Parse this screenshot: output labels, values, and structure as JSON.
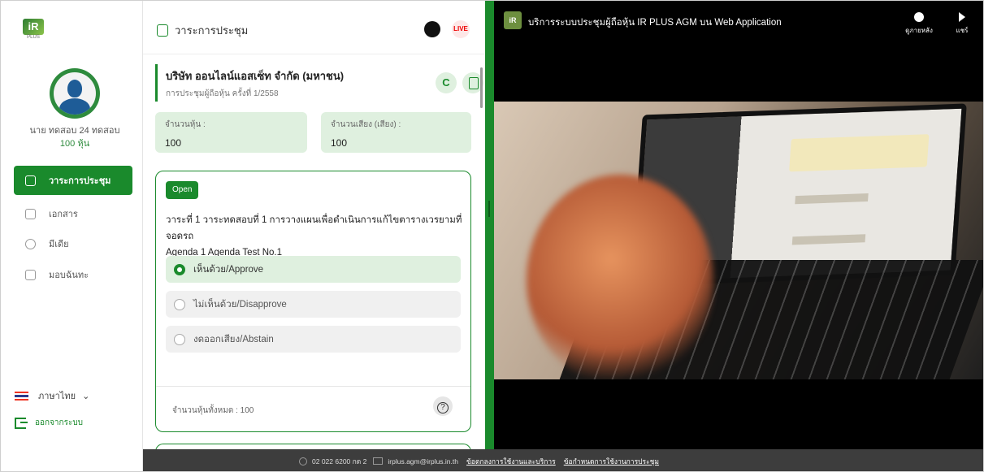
{
  "app": {
    "logo_text": "iR",
    "logo_sub": "PLUS"
  },
  "sidebar": {
    "user_name": "นาย ทดสอบ 24 ทดสอบ",
    "user_shares": "100 หุ้น",
    "items": [
      {
        "label": "วาระการประชุม",
        "icon": "agenda-icon",
        "active": true
      },
      {
        "label": "เอกสาร",
        "icon": "document-icon",
        "active": false
      },
      {
        "label": "มีเดีย",
        "icon": "media-icon",
        "active": false
      },
      {
        "label": "มอบฉันทะ",
        "icon": "proxy-icon",
        "active": false
      }
    ],
    "language": "ภาษาไทย",
    "logout": "ออกจากระบบ"
  },
  "agenda": {
    "title": "วาระการประชุม",
    "live_label": "LIVE",
    "refresh_symbol": "C",
    "company": "บริษัท ออนไลน์แอสเซ็ท จำกัด (มหาชน)",
    "meeting": "การประชุมผู้ถือหุ้น ครั้งที่ 1/2558",
    "stats": {
      "shares_label": "จำนวนหุ้น :",
      "shares_value": "100",
      "votes_label": "จำนวนเสียง (เสียง) :",
      "votes_value": "100"
    },
    "card": {
      "status": "Open",
      "text_th": "วาระที่ 1 วาระทดสอบที่ 1 การวางแผนเพื่อดำเนินการแก้ไขตารางเวรยามที่จอดรถ",
      "text_en": "Agenda 1 Agenda Test No.1",
      "options": [
        {
          "label": "เห็นด้วย/Approve",
          "selected": true
        },
        {
          "label": "ไม่เห็นด้วย/Disapprove",
          "selected": false
        },
        {
          "label": "งดออกเสียง/Abstain",
          "selected": false
        }
      ],
      "total": "จำนวนหุ้นทั้งหมด : 100",
      "help_symbol": "?"
    }
  },
  "video": {
    "channel_icon_text": "iR",
    "title": "บริการระบบประชุมผู้ถือหุ้น IR PLUS AGM บน Web Application",
    "watch_later": "ดูภายหลัง",
    "share": "แชร์"
  },
  "footer": {
    "phone": "02 022 6200 กด 2",
    "email": "irplus.agm@irplus.in.th",
    "terms": "ข้อตกลงการใช้งานและบริการ",
    "meeting_terms": "ข้อกำหนดการใช้งานการประชุม"
  },
  "colors": {
    "accent": "#1a8a2c",
    "light_accent": "#dff0df",
    "footer_bg": "#3d3d3d"
  }
}
